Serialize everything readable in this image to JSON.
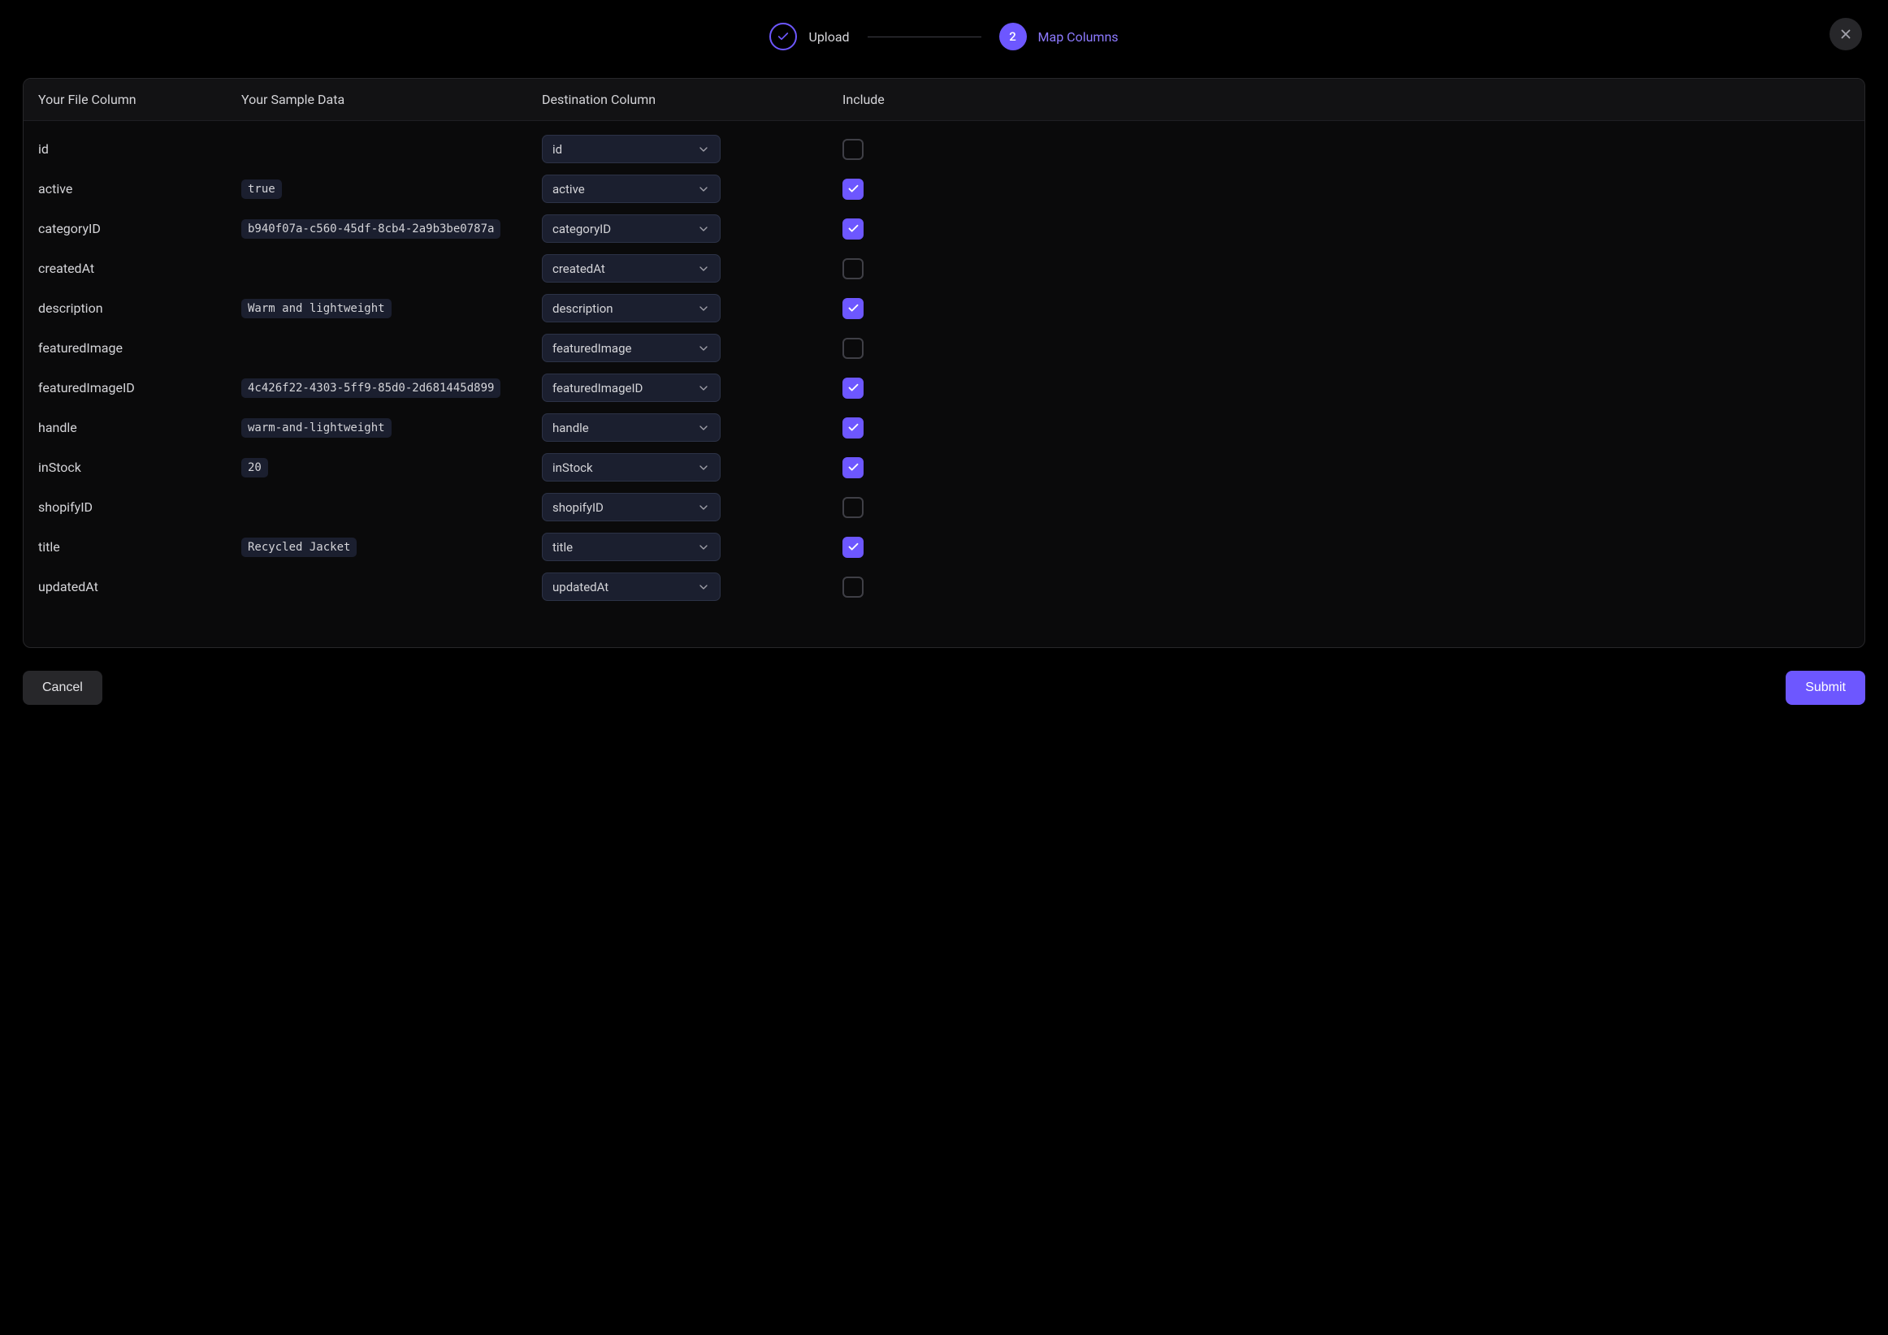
{
  "stepper": {
    "step1": {
      "label": "Upload"
    },
    "step2": {
      "number": "2",
      "label": "Map Columns"
    }
  },
  "table": {
    "headers": {
      "col1": "Your File Column",
      "col2": "Your Sample Data",
      "col3": "Destination Column",
      "col4": "Include"
    },
    "rows": [
      {
        "name": "id",
        "sample": "",
        "dest": "id",
        "included": false
      },
      {
        "name": "active",
        "sample": "true",
        "dest": "active",
        "included": true
      },
      {
        "name": "categoryID",
        "sample": "b940f07a-c560-45df-8cb4-2a9b3be0787a",
        "dest": "categoryID",
        "included": true
      },
      {
        "name": "createdAt",
        "sample": "",
        "dest": "createdAt",
        "included": false
      },
      {
        "name": "description",
        "sample": "Warm and lightweight",
        "dest": "description",
        "included": true
      },
      {
        "name": "featuredImage",
        "sample": "",
        "dest": "featuredImage",
        "included": false
      },
      {
        "name": "featuredImageID",
        "sample": "4c426f22-4303-5ff9-85d0-2d681445d899",
        "dest": "featuredImageID",
        "included": true
      },
      {
        "name": "handle",
        "sample": "warm-and-lightweight",
        "dest": "handle",
        "included": true
      },
      {
        "name": "inStock",
        "sample": "20",
        "dest": "inStock",
        "included": true
      },
      {
        "name": "shopifyID",
        "sample": "",
        "dest": "shopifyID",
        "included": false
      },
      {
        "name": "title",
        "sample": "Recycled Jacket",
        "dest": "title",
        "included": true
      },
      {
        "name": "updatedAt",
        "sample": "",
        "dest": "updatedAt",
        "included": false
      }
    ]
  },
  "footer": {
    "cancel": "Cancel",
    "submit": "Submit"
  }
}
